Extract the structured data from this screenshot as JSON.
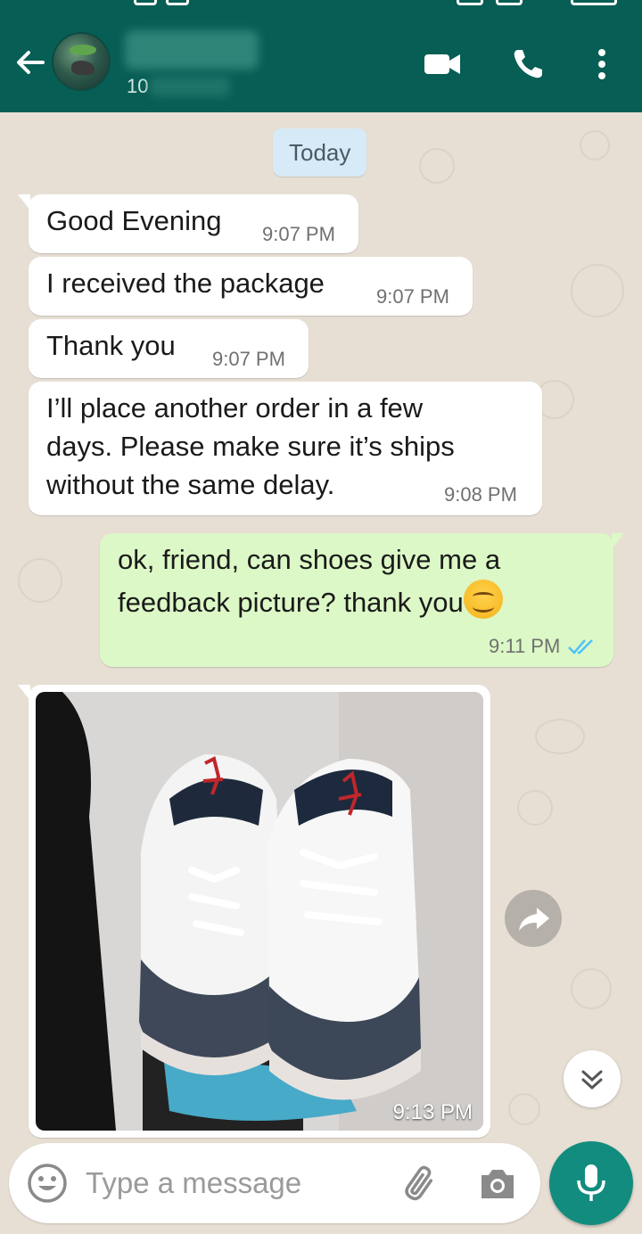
{
  "header": {
    "contact_sub": "10",
    "theme_color": "#075e54"
  },
  "chat": {
    "date_chip": "Today",
    "messages": [
      {
        "direction": "in",
        "text": "Good Evening",
        "time": "9:07 PM"
      },
      {
        "direction": "in",
        "text": "I received the package",
        "time": "9:07 PM"
      },
      {
        "direction": "in",
        "text": "Thank you",
        "time": "9:07 PM"
      },
      {
        "direction": "in",
        "lines": [
          "I’ll place another order in a few",
          "days. Please make sure it’s ships",
          "without the same delay."
        ],
        "time": "9:08 PM"
      },
      {
        "direction": "out",
        "lines": [
          "ok, friend, can shoes give me a",
          "feedback picture? thank you"
        ],
        "emoji": "smiling-face",
        "time": "9:11 PM",
        "status": "read"
      },
      {
        "direction": "in",
        "type": "image",
        "image_subject": "sneakers",
        "time": "9:13 PM"
      }
    ],
    "outgoing_bubble_color": "#dcf8c6",
    "read_tick_color": "#4fc3f7"
  },
  "composer": {
    "placeholder": "Type a message",
    "value": "",
    "mic_color": "#128c7e"
  }
}
